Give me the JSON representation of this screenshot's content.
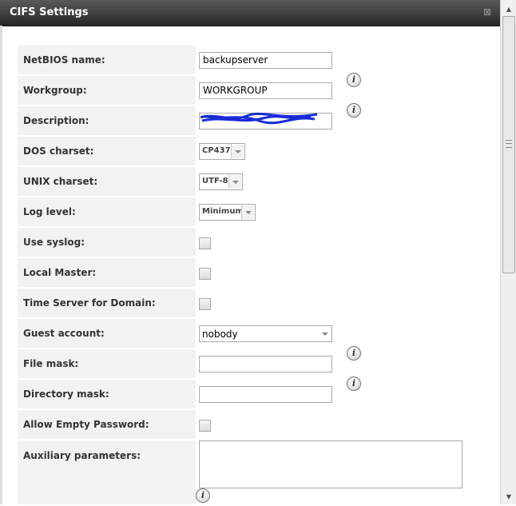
{
  "window": {
    "title": "CIFS Settings",
    "close_glyph": "⊠"
  },
  "form": {
    "netbios": {
      "label": "NetBIOS name:",
      "value": "backupserver"
    },
    "workgroup": {
      "label": "Workgroup:",
      "value": "WORKGROUP"
    },
    "description": {
      "label": "Description:",
      "value": ""
    },
    "dos_charset": {
      "label": "DOS charset:",
      "value": "CP437"
    },
    "unix_charset": {
      "label": "UNIX charset:",
      "value": "UTF-8"
    },
    "log_level": {
      "label": "Log level:",
      "value": "Minimum"
    },
    "use_syslog": {
      "label": "Use syslog:"
    },
    "local_master": {
      "label": "Local Master:"
    },
    "time_server": {
      "label": "Time Server for Domain:"
    },
    "guest_account": {
      "label": "Guest account:",
      "value": "nobody"
    },
    "file_mask": {
      "label": "File mask:",
      "value": ""
    },
    "directory_mask": {
      "label": "Directory mask:",
      "value": ""
    },
    "allow_empty_password": {
      "label": "Allow Empty Password:"
    },
    "auxiliary": {
      "label": "Auxiliary parameters:",
      "value": ""
    }
  },
  "icons": {
    "info": "i",
    "scroll_up": "▲",
    "scroll_down": "▼"
  },
  "colors": {
    "titlebar": "#3a3a3a",
    "label_bg": "#f2f2f2",
    "redaction": "#1a2bd6"
  }
}
